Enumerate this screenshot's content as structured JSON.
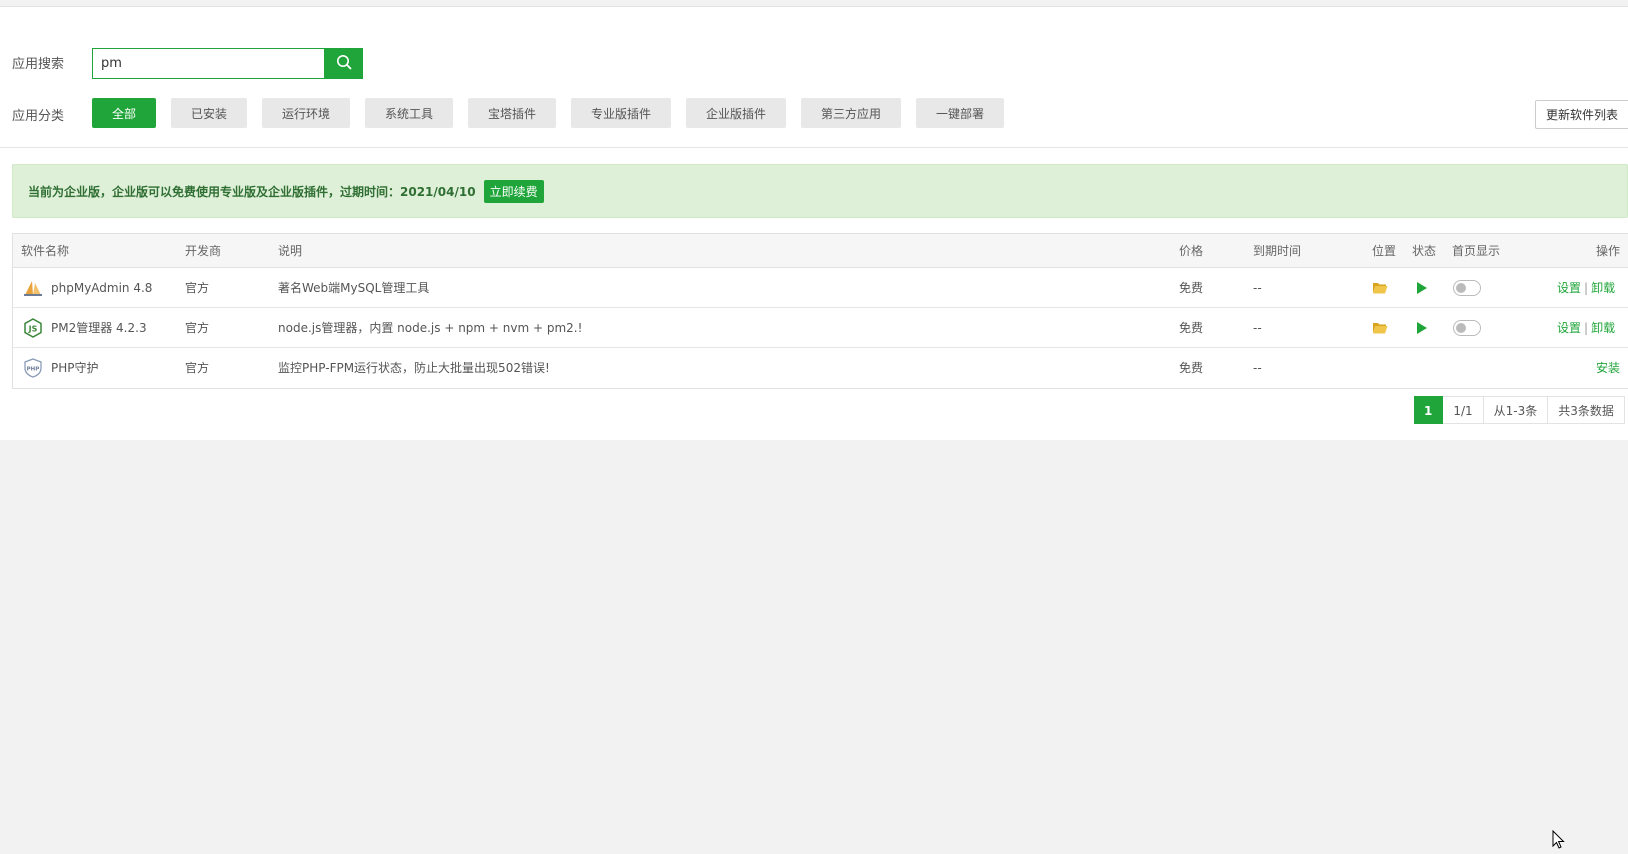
{
  "search": {
    "label": "应用搜索",
    "value": "pm",
    "button_icon": "search-icon"
  },
  "categories": {
    "label": "应用分类",
    "items": [
      {
        "label": "全部",
        "active": true
      },
      {
        "label": "已安装",
        "active": false
      },
      {
        "label": "运行环境",
        "active": false
      },
      {
        "label": "系统工具",
        "active": false
      },
      {
        "label": "宝塔插件",
        "active": false
      },
      {
        "label": "专业版插件",
        "active": false
      },
      {
        "label": "企业版插件",
        "active": false
      },
      {
        "label": "第三方应用",
        "active": false
      },
      {
        "label": "一键部署",
        "active": false
      }
    ]
  },
  "refresh_button": "更新软件列表",
  "notice": {
    "text": "当前为企业版，企业版可以免费使用专业版及企业版插件，过期时间：2021/04/10",
    "renew_label": "立即续费"
  },
  "table": {
    "headers": {
      "name": "软件名称",
      "developer": "开发商",
      "description": "说明",
      "price": "价格",
      "expiry": "到期时间",
      "location": "位置",
      "status": "状态",
      "homepage": "首页显示",
      "action": "操作"
    },
    "rows": [
      {
        "name": "phpMyAdmin 4.8",
        "icon": "phpmyadmin-icon",
        "developer": "官方",
        "description": "著名Web端MySQL管理工具",
        "price": "免费",
        "expiry": "--",
        "installed": true,
        "settings_label": "设置",
        "separator": "|",
        "uninstall_label": "卸载"
      },
      {
        "name": "PM2管理器 4.2.3",
        "icon": "nodejs-icon",
        "developer": "官方",
        "description": "node.js管理器，内置 node.js + npm + nvm + pm2.!",
        "price": "免费",
        "expiry": "--",
        "installed": true,
        "settings_label": "设置",
        "separator": "|",
        "uninstall_label": "卸载"
      },
      {
        "name": "PHP守护",
        "icon": "php-shield-icon",
        "developer": "官方",
        "description": "监控PHP-FPM运行状态，防止大批量出现502错误!",
        "price": "免费",
        "expiry": "--",
        "installed": false,
        "install_label": "安装"
      }
    ]
  },
  "pagination": {
    "current": "1",
    "pages": "1/1",
    "range": "从1-3条",
    "total": "共3条数据"
  },
  "colors": {
    "accent": "#20a53a",
    "notice_bg": "#dff0d8",
    "folder": "#e8b82e"
  }
}
